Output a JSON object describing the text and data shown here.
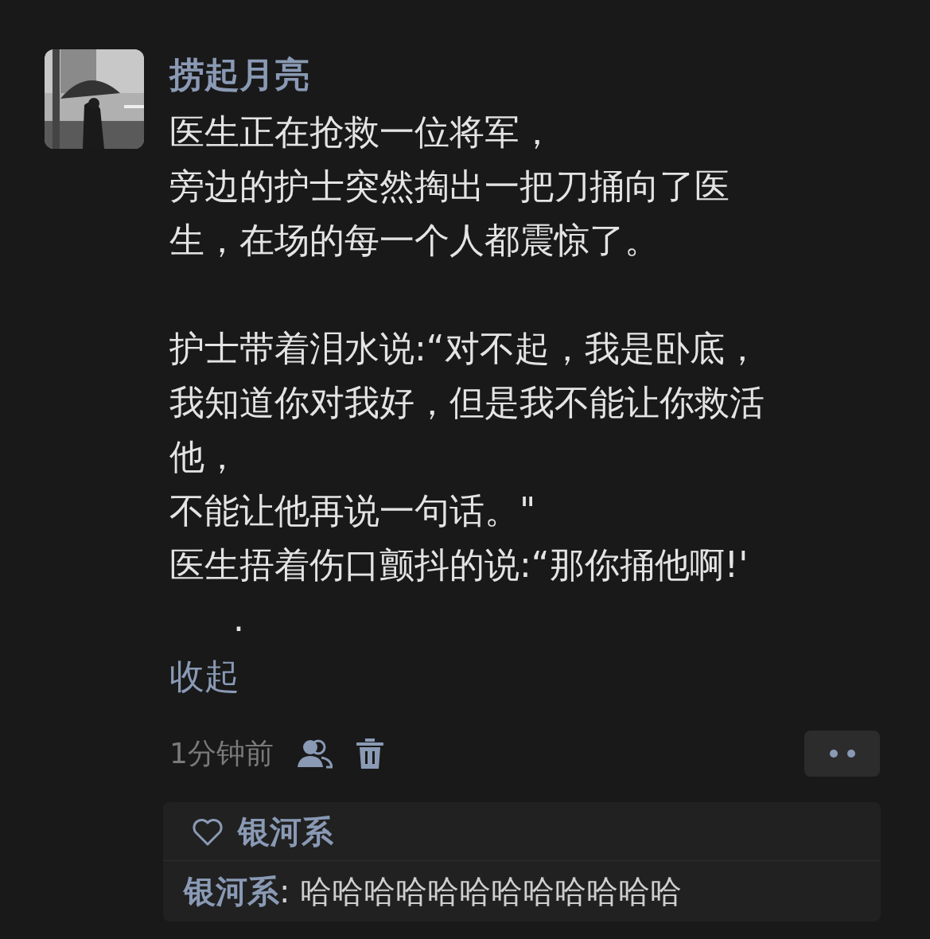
{
  "post": {
    "author": "捞起月亮",
    "paragraphs": [
      [
        "医生正在抢救一位将军，",
        "旁边的护士突然掏出一把刀捅向了医",
        "生，在场的每一个人都震惊了。"
      ],
      [
        "护士带着泪水说:“对不起，我是卧底，",
        "我知道你对我好，但是我不能让你救活",
        "他，",
        "不能让他再说一句话。\"",
        "医生捂着伤口颤抖的说:“那你捅他啊!'"
      ]
    ],
    "trailing_mark": ".",
    "collapse_link": "收起",
    "time": "1分钟前"
  },
  "likes": [
    "银河系"
  ],
  "comments": [
    {
      "author": "银河系",
      "separator": ":",
      "text": "哈哈哈哈哈哈哈哈哈哈哈哈"
    }
  ]
}
